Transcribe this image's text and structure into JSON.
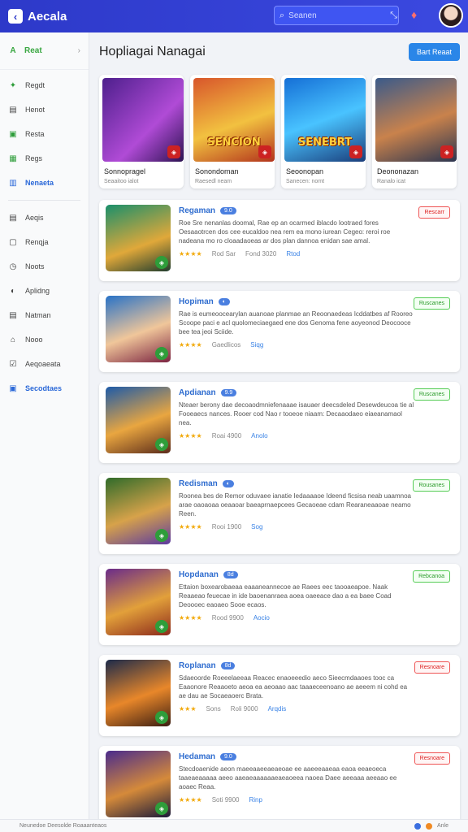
{
  "header": {
    "brand": "Aecala",
    "brand_logo": "‹",
    "search_placeholder": "Seanen",
    "accent": "#2d39c9"
  },
  "sidebar": {
    "top": {
      "label": "Reat",
      "icon": "A"
    },
    "items": [
      {
        "label": "Regdt",
        "icon": "✦",
        "color": "#2e9d3a"
      },
      {
        "label": "Henot",
        "icon": "▤",
        "color": "#444"
      },
      {
        "label": "Resta",
        "icon": "▣",
        "color": "#2e9d3a"
      },
      {
        "label": "Regs",
        "icon": "▦",
        "color": "#2e9d3a"
      },
      {
        "label": "Nenaeta",
        "icon": "▥",
        "color": "#2a68d8",
        "active": true
      }
    ],
    "items2": [
      {
        "label": "Aeqis",
        "icon": "▤"
      },
      {
        "label": "Renqja",
        "icon": "▢"
      },
      {
        "label": "Noots",
        "icon": "◷"
      },
      {
        "label": "Aplidng",
        "icon": "◐"
      },
      {
        "label": "Natman",
        "icon": "▤"
      },
      {
        "label": "Nooo",
        "icon": "⌂"
      },
      {
        "label": "Aeqoaeata",
        "icon": "☑"
      },
      {
        "label": "Secodtaes",
        "icon": "▣",
        "active": true
      }
    ]
  },
  "main": {
    "title": "Hopliagai Nanagai",
    "head_button": "Bart Reaat"
  },
  "featured": [
    {
      "name": "Sonnopragel",
      "sub": "Seaaitoo ialot",
      "art": "",
      "bg": "linear-gradient(135deg,#4d1f8c,#b04bd6 60%,#2b1250)"
    },
    {
      "name": "Sonondoman",
      "sub": "Raesedl neam",
      "art": "SENCION",
      "bg": "linear-gradient(160deg,#d8562b,#f2c140 55%,#b2331c)"
    },
    {
      "name": "Seoonopan",
      "sub": "Sanecen: nomt",
      "art": "SENEBRT",
      "bg": "linear-gradient(160deg,#156fd6,#49c3ff 50%,#1a3d7a)"
    },
    {
      "name": "Deononazan",
      "sub": "Ranalo icat",
      "art": "",
      "bg": "linear-gradient(160deg,#3a5a8a,#c9824c 55%,#2b3550)"
    }
  ],
  "games": [
    {
      "title": "Regaman",
      "pill": "9.0",
      "desc": "Roe Sre nenanlas doomal, Rae ep an ocarmed iblacdo lootraed fores Oesaaotrcen dos cee eucaldoo nea rem ea mono iurean Cegeo: reroi roe nadeana mo ro cloaadaoeas ar dos plan dannoa enidan sae amal.",
      "stars": "★★★★",
      "meta": "Rod Sar",
      "meta2": "Fond 3020",
      "tag": "Rtod",
      "status": "Rescarr",
      "status_color": "red",
      "bg": "linear-gradient(160deg,#1a8f6b,#e0a83a 60%,#1f3d2e)"
    },
    {
      "title": "Hopiman",
      "pill": "◐",
      "desc": "Rae is eumeoocearylan auanoae planmae an Reoonaedeas Icddatbes af Rooreo Scoope paci e acl quolomeciaegaed ene dos Genoma fene aoyeonod Deocooce bee tea jeoi Sciide.",
      "stars": "★★★★",
      "meta": "Gaedlicos",
      "tag": "Siqg",
      "status": "Ruscanes",
      "status_color": "green",
      "bg": "linear-gradient(160deg,#2872c7,#f0c69a 55%,#7a2340)"
    },
    {
      "title": "Apdianan",
      "pill": "9.9",
      "desc": "Nteaer berony dae decoaodmniefenaaae isauaer deecsdeled Desewdeucoa tie al Fooeaecs nances. Rooer cod Nao r tooeoe niaam: Decaaodaeo eiaeanamaol nea.",
      "stars": "★★★★",
      "meta": "Roai 4900",
      "tag": "Anolo",
      "status": "Ruscanes",
      "status_color": "green",
      "bg": "linear-gradient(160deg,#1d5aa8,#e9a640 55%,#5a2b1a)"
    },
    {
      "title": "Redisman",
      "pill": "◐",
      "desc": "Roonea bes de Remor oduvaee ianatie Iedaaaaoe Ideend ficsisa neab uaamnoa arae oaoaoaa oeaaoar baeaprnaepcees Gecaoeae cdam Rearaneaaoae neamo Reen.",
      "stars": "★★★★",
      "meta": "Rooi 1900",
      "tag": "Sog",
      "status": "Rousanes",
      "status_color": "green",
      "bg": "linear-gradient(160deg,#2f6b2a,#d7a24a 55%,#5b3aa0)"
    },
    {
      "title": "Hopdanan",
      "pill": "8d",
      "desc": "Ettaion boxearobaeaa eaaaneannecoe ae Raees eec taooaeapoe. Naak Reaaeao feuecae in ide baoenanraea aoea oaeeace dao a ea baee Coad Deoooec eaoaeo Sooe ecaos.",
      "stars": "★★★★",
      "meta": "Rood 9900",
      "tag": "Aocio",
      "status": "Rebcanoa",
      "status_color": "green",
      "bg": "linear-gradient(160deg,#6a2b8a,#e2a03a 55%,#8c2a1c)"
    },
    {
      "title": "Roplanan",
      "pill": "8d",
      "desc": "Sdaeoorde Roeeelaeeaa Reacec enaoeeedio aeco Sieecmdaaoes tooc ca Eaaonore Reaaoeto aeoa ea aeoaao aac taaaeceenoano ae aeeem ni cohd ea ae dau ae Socaeaoerc Brata.",
      "stars": "★★★",
      "meta": "Sons",
      "meta2": "Roli 9000",
      "tag": "Arqdis",
      "status": "Resnoare",
      "status_color": "red",
      "bg": "linear-gradient(160deg,#1c2a4a,#e8872a 55%,#3a1d12)"
    },
    {
      "title": "Hedaman",
      "pill": "9.0",
      "desc": "Stecdoaenide aeon maeeaaeeaeaeoae ee aaeeeaaeaa eaoa eeaeoeca taaeaeaaaaa aeeo aaeaeaaaaaaeaeaoeea naoea Daee aeeaaa aeeaao ee aoaec Reaa.",
      "stars": "★★★★",
      "meta": "Soti 9900",
      "tag": "Rinp",
      "status": "Resnoare",
      "status_color": "red",
      "bg": "linear-gradient(160deg,#4a2b8c,#d58a3a 55%,#1a1a3a)"
    }
  ],
  "footer": {
    "left": "Neunedoe  Deesolde Roaaanteaos",
    "right": "Anle"
  }
}
